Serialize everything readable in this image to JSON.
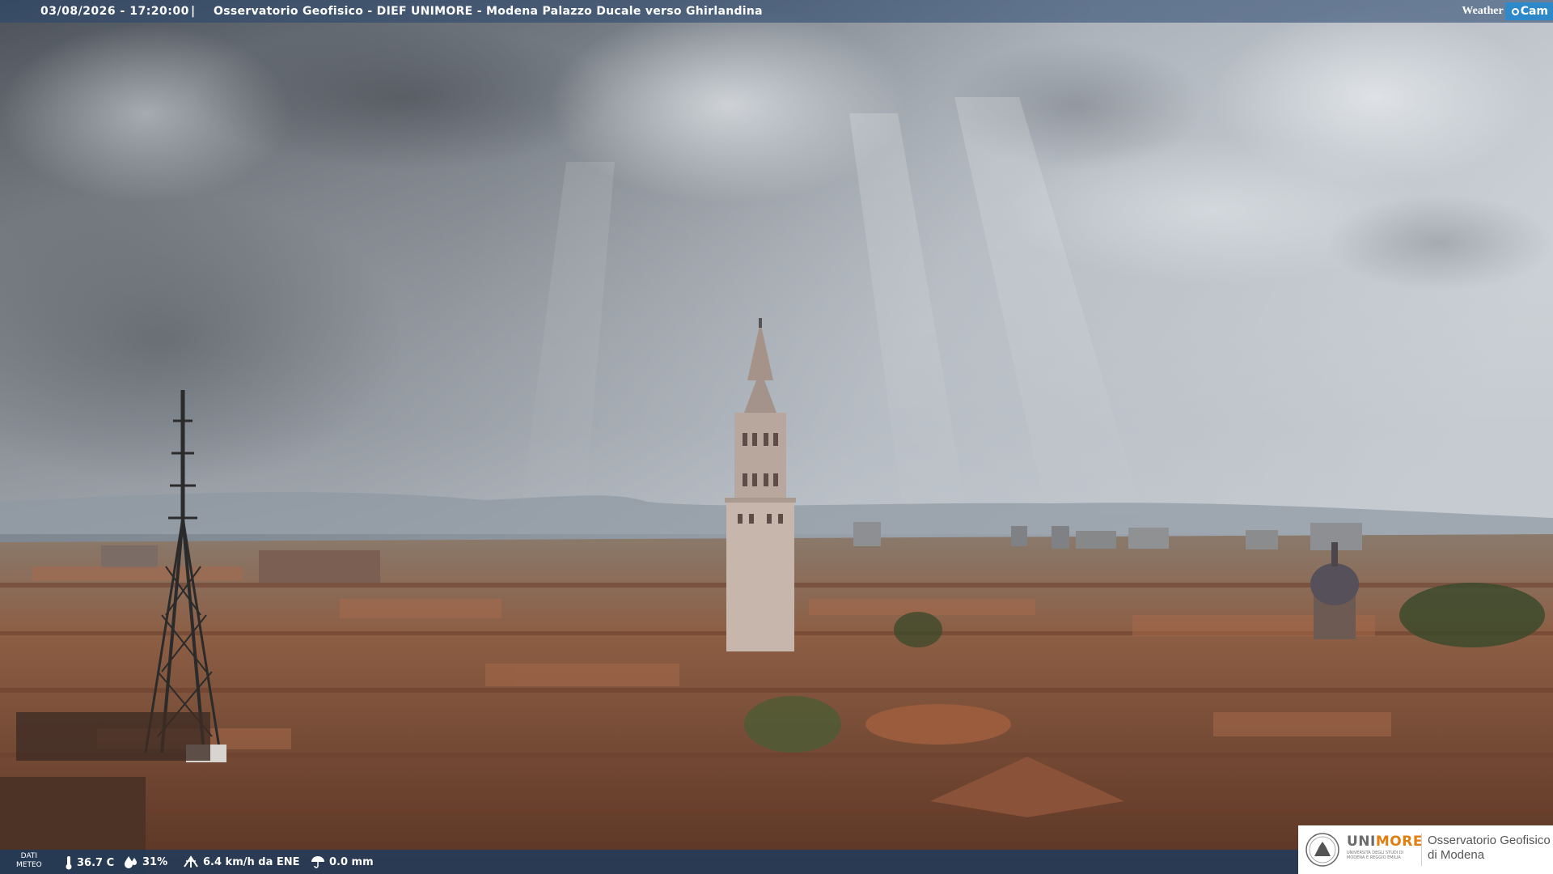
{
  "header": {
    "datetime": "03/08/2026 - 17:20:00",
    "separator": "|",
    "title": "Osservatorio Geofisico - DIEF UNIMORE - Modena Palazzo Ducale verso Ghirlandina"
  },
  "brand": {
    "weather": "Weather",
    "cam": "Cam"
  },
  "meteo": {
    "label_line1": "DATI",
    "label_line2": "METEO",
    "temperature": "36.7 C",
    "humidity": "31%",
    "wind": "6.4 km/h da ENE",
    "rain": "0.0 mm"
  },
  "logo": {
    "name_gray": "UNI",
    "name_orange": "MORE",
    "subtitle": "UNIVERSITÀ DEGLI STUDI DI MODENA E REGGIO EMILIA",
    "org_line1": "Osservatorio Geofisico",
    "org_line2": "di Modena"
  },
  "colors": {
    "bar": "#284670",
    "accent": "#2d89c9",
    "unimore_orange": "#e07f10"
  }
}
